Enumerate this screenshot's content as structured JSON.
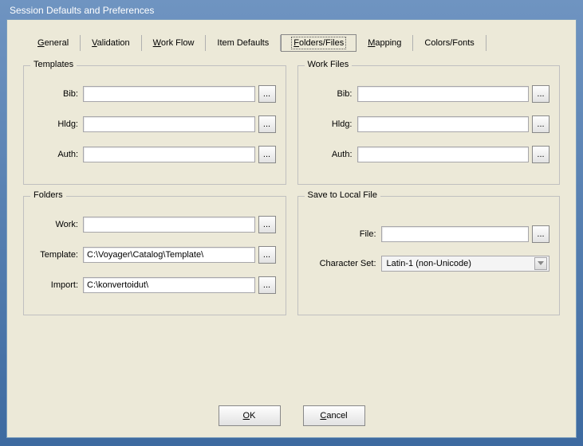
{
  "title": "Session Defaults and Preferences",
  "tabs": [
    {
      "accel": "G",
      "rest": "eneral"
    },
    {
      "accel": "V",
      "rest": "alidation"
    },
    {
      "accel": "W",
      "rest": "ork Flow"
    },
    {
      "plain": "Item Defaults"
    },
    {
      "accel": "F",
      "rest": "olders/Files",
      "active": true
    },
    {
      "accel": "M",
      "rest": "apping"
    },
    {
      "plain": "Colors/Fonts"
    }
  ],
  "templates": {
    "legend": "Templates",
    "bib_label": "Bib:",
    "bib_value": "",
    "hldg_label": "Hldg:",
    "hldg_value": "",
    "auth_label": "Auth:",
    "auth_value": ""
  },
  "workfiles": {
    "legend": "Work Files",
    "bib_label": "Bib:",
    "bib_value": "",
    "hldg_label": "Hldg:",
    "hldg_value": "",
    "auth_label": "Auth:",
    "auth_value": ""
  },
  "folders": {
    "legend": "Folders",
    "work_label": "Work:",
    "work_value": "",
    "template_label": "Template:",
    "template_value": "C:\\Voyager\\Catalog\\Template\\",
    "import_label": "Import:",
    "import_value": "C:\\konvertoidut\\"
  },
  "save": {
    "legend": "Save to Local File",
    "file_label": "File:",
    "file_value": "",
    "charset_label": "Character Set:",
    "charset_value": "Latin-1 (non-Unicode)"
  },
  "browse_label": "...",
  "buttons": {
    "ok_accel": "O",
    "ok_rest": "K",
    "cancel_accel": "C",
    "cancel_rest": "ancel"
  }
}
